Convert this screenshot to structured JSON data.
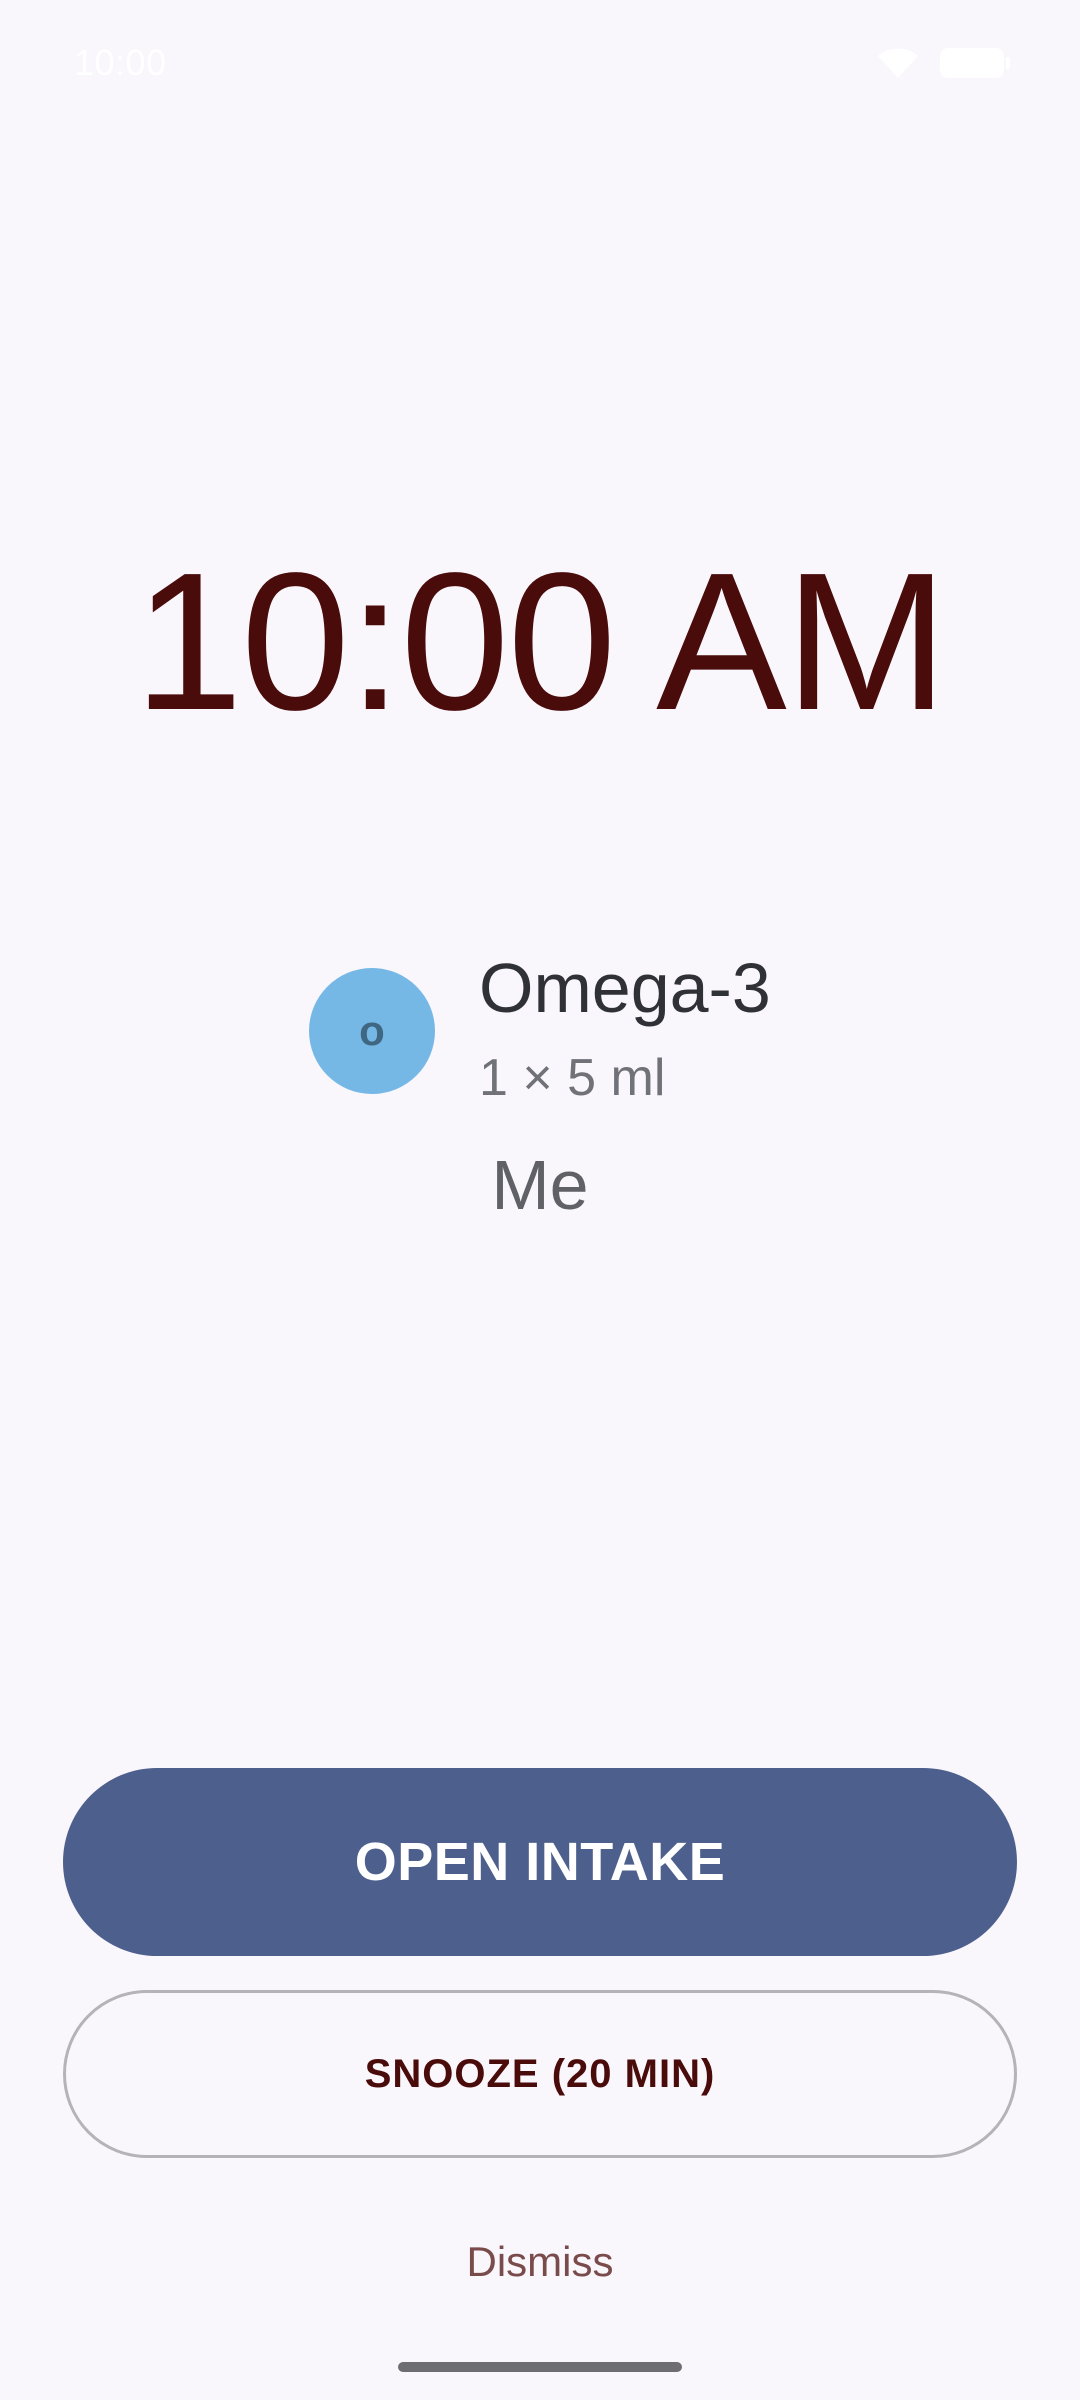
{
  "status_bar": {
    "time": "10:00",
    "wifi_icon": "wifi-icon",
    "battery_icon": "battery-icon"
  },
  "alarm": {
    "time": "10:00 AM"
  },
  "medication": {
    "avatar_letter": "o",
    "avatar_color": "#75b8e6",
    "name": "Omega-3",
    "dose": "1 × 5 ml",
    "person": "Me"
  },
  "actions": {
    "open_intake_label": "OPEN INTAKE",
    "snooze_label": "SNOOZE (20 MIN)",
    "dismiss_label": "Dismiss"
  },
  "colors": {
    "background": "#f9f6fc",
    "accent_primary": "#4d5f8c",
    "text_dark_red": "#4a0b0b"
  }
}
